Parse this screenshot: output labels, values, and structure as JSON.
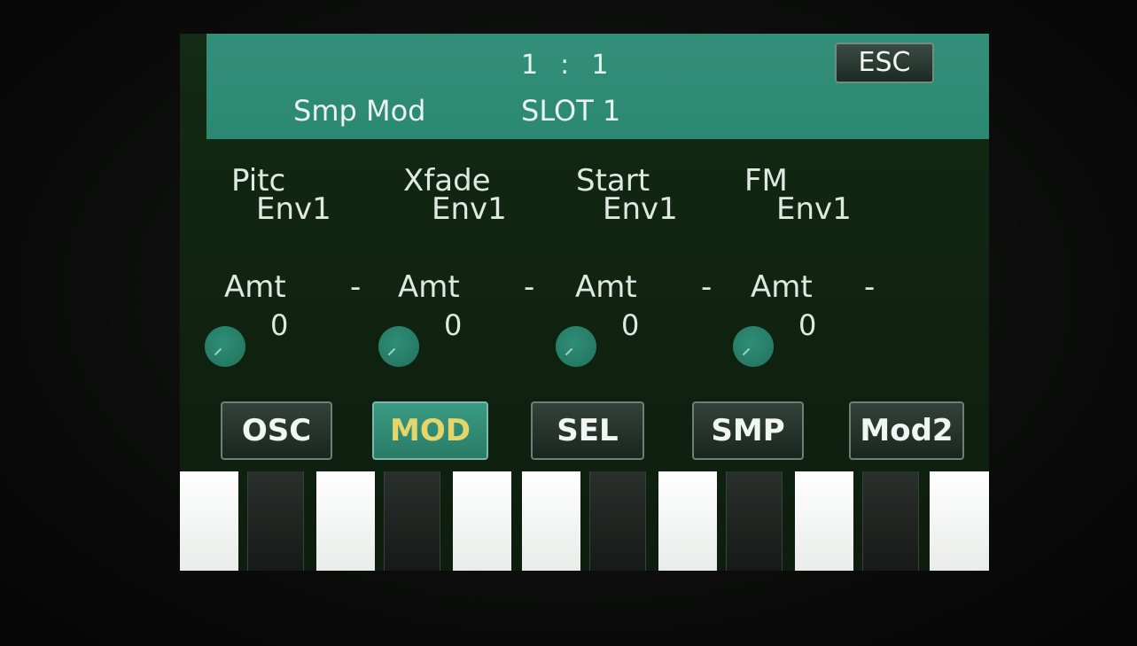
{
  "header": {
    "position": "1  :  1",
    "title": "Smp Mod",
    "slot": "SLOT 1",
    "esc_label": "ESC"
  },
  "params": [
    {
      "name": "Pitc",
      "value": "Env1",
      "amt_label": "Amt",
      "amt_value": "0",
      "dash": "-"
    },
    {
      "name": "Xfade",
      "value": "Env1",
      "amt_label": "Amt",
      "amt_value": "0",
      "dash": "-"
    },
    {
      "name": "Start",
      "value": "Env1",
      "amt_label": "Amt",
      "amt_value": "0",
      "dash": "-"
    },
    {
      "name": "FM",
      "value": "Env1",
      "amt_label": "Amt",
      "amt_value": "0",
      "dash": "-"
    }
  ],
  "tabs": [
    {
      "label": "OSC",
      "active": false
    },
    {
      "label": "MOD",
      "active": true
    },
    {
      "label": "SEL",
      "active": false
    },
    {
      "label": "SMP",
      "active": false
    },
    {
      "label": "Mod2",
      "active": false
    }
  ],
  "colors": {
    "header_bg": "#2e8f78",
    "screen_bg": "#10230f",
    "active_tab_text": "#e4d66a",
    "knob": "#2f8e76"
  }
}
